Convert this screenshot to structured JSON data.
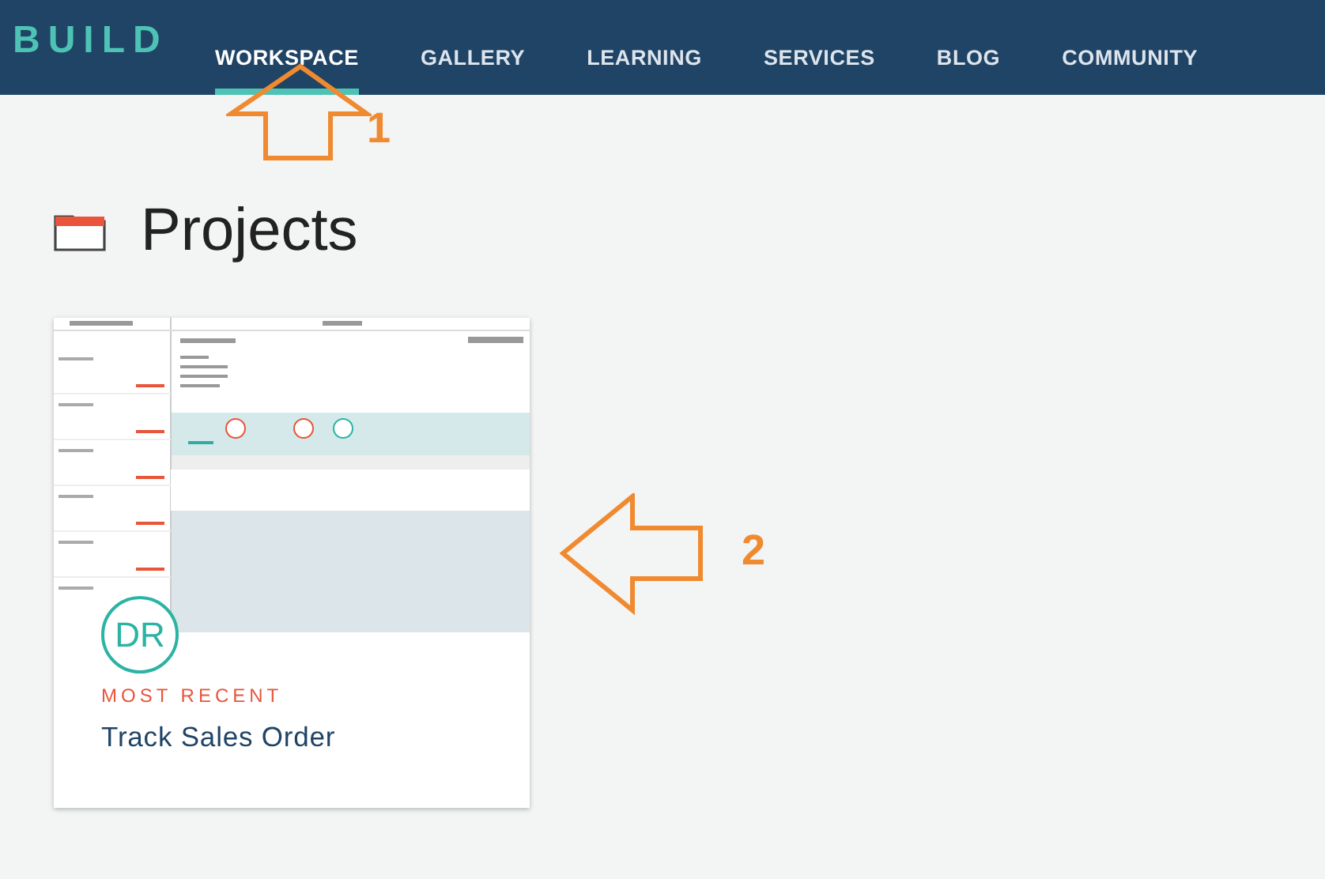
{
  "brand": "BUILD",
  "nav": [
    {
      "label": "WORKSPACE",
      "selected": true
    },
    {
      "label": "GALLERY",
      "selected": false
    },
    {
      "label": "LEARNING",
      "selected": false
    },
    {
      "label": "SERVICES",
      "selected": false
    },
    {
      "label": "BLOG",
      "selected": false
    },
    {
      "label": "COMMUNITY",
      "selected": false
    }
  ],
  "page_title": "Projects",
  "projects": [
    {
      "avatar": "DR",
      "tag": "MOST RECENT",
      "title": "Track Sales Order"
    }
  ],
  "annotations": [
    {
      "kind": "up-arrow",
      "number": "1"
    },
    {
      "kind": "left-arrow",
      "number": "2"
    }
  ]
}
